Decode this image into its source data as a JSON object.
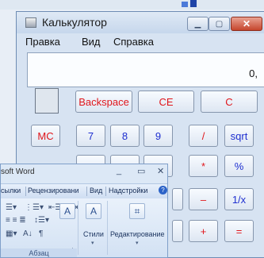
{
  "calculator": {
    "title": "Калькулятор",
    "menu": [
      "Правка",
      "Вид",
      "Справка"
    ],
    "display_value": "0,",
    "buttons": {
      "backspace": "Backspace",
      "ce": "CE",
      "c": "C",
      "mc": "MC",
      "seven": "7",
      "eight": "8",
      "nine": "9",
      "divide": "/",
      "sqrt": "sqrt",
      "multiply": "*",
      "percent": "%",
      "minus": "–",
      "reciprocal": "1/x",
      "plus": "+",
      "equals": "="
    },
    "colors": {
      "red_label": "#e0161b",
      "blue_label": "#1e2fd0"
    }
  },
  "word": {
    "title": "soft Word",
    "tabs": [
      "сылки",
      "Рецензировани",
      "Вид",
      "Надстройки"
    ],
    "group_paragraph": "Абзац",
    "styles_label": "Стили",
    "editing_label": "Редактирование"
  }
}
